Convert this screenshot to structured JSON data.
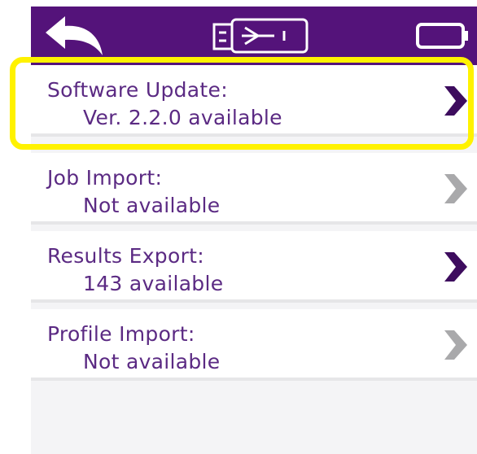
{
  "header": {
    "back_icon": "back-arrow-icon",
    "usb_icon": "usb-drive-icon",
    "battery_icon": "battery-icon",
    "background_color": "#54137a"
  },
  "menu": {
    "items": [
      {
        "title": "Software Update:",
        "status": "Ver. 2.2.0 available",
        "enabled": true,
        "chevron_color": "#3d0c5e",
        "highlighted": true
      },
      {
        "title": "Job Import:",
        "status": "Not available",
        "enabled": false,
        "chevron_color": "#a9a9ab",
        "highlighted": false
      },
      {
        "title": "Results Export:",
        "status": "143 available",
        "enabled": true,
        "chevron_color": "#3d0c5e",
        "highlighted": false
      },
      {
        "title": "Profile Import:",
        "status": "Not available",
        "enabled": false,
        "chevron_color": "#a9a9ab",
        "highlighted": false
      }
    ]
  },
  "highlight_color": "#fff200"
}
